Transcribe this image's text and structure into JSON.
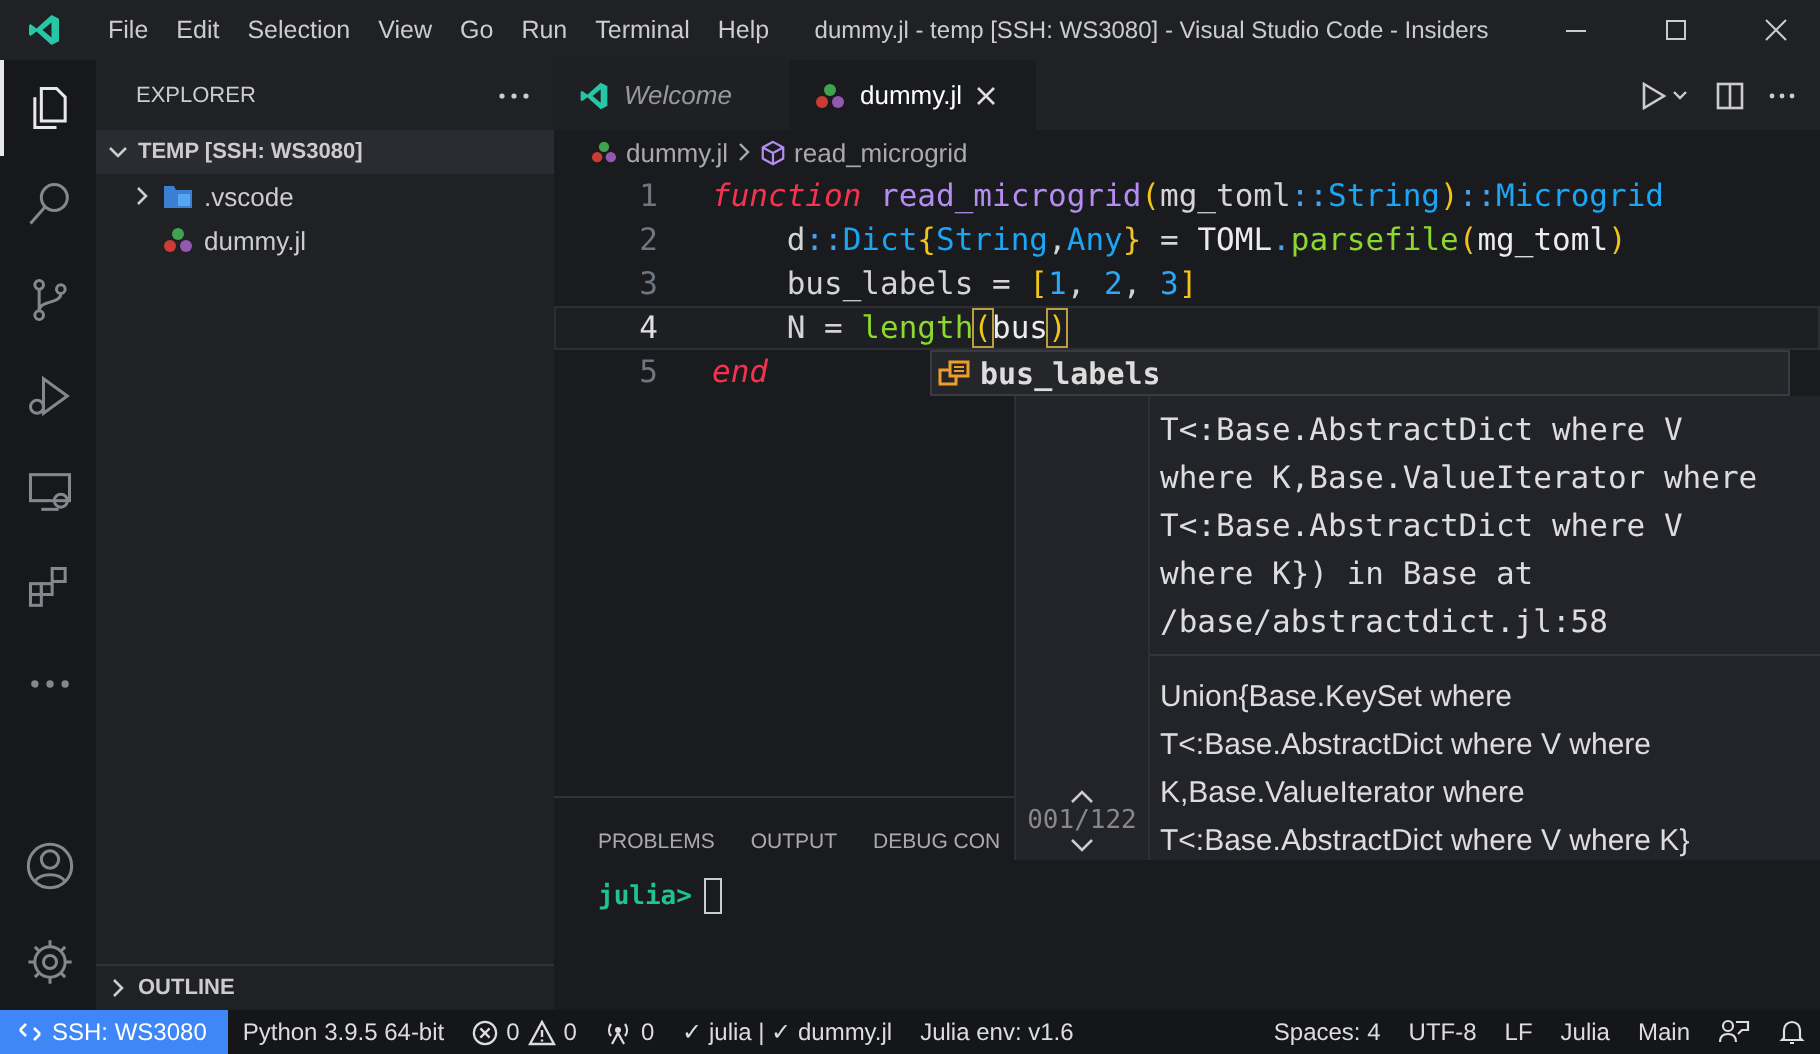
{
  "title_bar": {
    "menu": [
      "File",
      "Edit",
      "Selection",
      "View",
      "Go",
      "Run",
      "Terminal",
      "Help"
    ],
    "title": "dummy.jl - temp [SSH: WS3080] - Visual Studio Code - Insiders"
  },
  "activity_bar": {
    "items": [
      {
        "selected": true
      },
      {
        "selected": false
      },
      {
        "selected": false
      },
      {
        "selected": false
      },
      {
        "selected": false
      },
      {
        "selected": false
      },
      {
        "selected": false
      }
    ]
  },
  "sidebar": {
    "title": "EXPLORER",
    "folder": {
      "label": "TEMP [SSH: WS3080]",
      "expanded": true,
      "items": [
        {
          "label": ".vscode",
          "kind": "folder",
          "expanded": false
        },
        {
          "label": "dummy.jl",
          "kind": "file"
        }
      ]
    },
    "outline": {
      "label": "OUTLINE",
      "expanded": false
    }
  },
  "tabs": [
    {
      "label": "Welcome",
      "selected": false,
      "preview": true
    },
    {
      "label": "dummy.jl",
      "selected": true,
      "preview": false
    }
  ],
  "breadcrumb": [
    "dummy.jl",
    "read_microgrid"
  ],
  "code_lines": [
    {
      "number": "1",
      "current": false,
      "tokens": [
        {
          "text": "function ",
          "kind": "keyword"
        },
        {
          "text": "read_microgrid",
          "kind": "function"
        },
        {
          "text": "(",
          "kind": "bracket"
        },
        {
          "text": "mg_toml",
          "kind": "plain"
        },
        {
          "text": "::",
          "kind": "op"
        },
        {
          "text": "String",
          "kind": "type"
        },
        {
          "text": ")",
          "kind": "bracket"
        },
        {
          "text": "::",
          "kind": "op"
        },
        {
          "text": "Microgrid",
          "kind": "type"
        }
      ]
    },
    {
      "number": "2",
      "current": false,
      "tokens": [
        {
          "text": "    d",
          "kind": "plain"
        },
        {
          "text": "::",
          "kind": "op"
        },
        {
          "text": "Dict",
          "kind": "type"
        },
        {
          "text": "{",
          "kind": "bracket"
        },
        {
          "text": "String",
          "kind": "type"
        },
        {
          "text": ",",
          "kind": "plain"
        },
        {
          "text": "Any",
          "kind": "type"
        },
        {
          "text": "}",
          "kind": "bracket"
        },
        {
          "text": " = ",
          "kind": "plain"
        },
        {
          "text": "TOML",
          "kind": "module"
        },
        {
          "text": ".",
          "kind": "op"
        },
        {
          "text": "parsefile",
          "kind": "call"
        },
        {
          "text": "(",
          "kind": "bracket"
        },
        {
          "text": "mg_toml",
          "kind": "module"
        },
        {
          "text": ")",
          "kind": "bracket"
        }
      ]
    },
    {
      "number": "3",
      "current": false,
      "tokens": [
        {
          "text": "    bus_labels = ",
          "kind": "plain"
        },
        {
          "text": "[",
          "kind": "bracket"
        },
        {
          "text": "1",
          "kind": "number"
        },
        {
          "text": ", ",
          "kind": "plain"
        },
        {
          "text": "2",
          "kind": "number"
        },
        {
          "text": ", ",
          "kind": "plain"
        },
        {
          "text": "3",
          "kind": "number"
        },
        {
          "text": "]",
          "kind": "bracket"
        }
      ]
    },
    {
      "number": "4",
      "current": true,
      "tokens": [
        {
          "text": "    N = ",
          "kind": "plain"
        },
        {
          "text": "length",
          "kind": "call"
        },
        {
          "text": "(",
          "kind": "match"
        },
        {
          "text": "bus",
          "kind": "module"
        },
        {
          "text": ")",
          "kind": "match"
        }
      ]
    },
    {
      "number": "5",
      "current": false,
      "tokens": [
        {
          "text": "end",
          "kind": "keyword"
        }
      ]
    }
  ],
  "suggest": {
    "label": "bus_labels"
  },
  "hover": {
    "counter": "001/122",
    "sections": [
      {
        "kind": "code",
        "lines": [
          "T<:Base.AbstractDict where V",
          "where K,Base.ValueIterator where",
          "T<:Base.AbstractDict where V",
          "where K}) in Base at",
          "/base/abstractdict.jl:58"
        ]
      },
      {
        "kind": "prose",
        "lines": [
          "Union{Base.KeySet where",
          "T<:Base.AbstractDict where V where",
          "K,Base.ValueIterator where",
          "T<:Base.AbstractDict where V where K}"
        ]
      }
    ]
  },
  "panel": {
    "tabs": [
      "PROBLEMS",
      "OUTPUT",
      "DEBUG CON"
    ],
    "prompt": "julia>"
  },
  "status_bar": {
    "remote": "SSH: WS3080",
    "python": "Python 3.9.5 64-bit",
    "errors": "0",
    "warnings": "0",
    "ports": "0",
    "julia_status": "✓ julia | ✓ dummy.jl",
    "julia_env": "Julia env: v1.6",
    "right": [
      "Spaces: 4",
      "UTF-8",
      "LF",
      "Julia",
      "Main"
    ]
  }
}
